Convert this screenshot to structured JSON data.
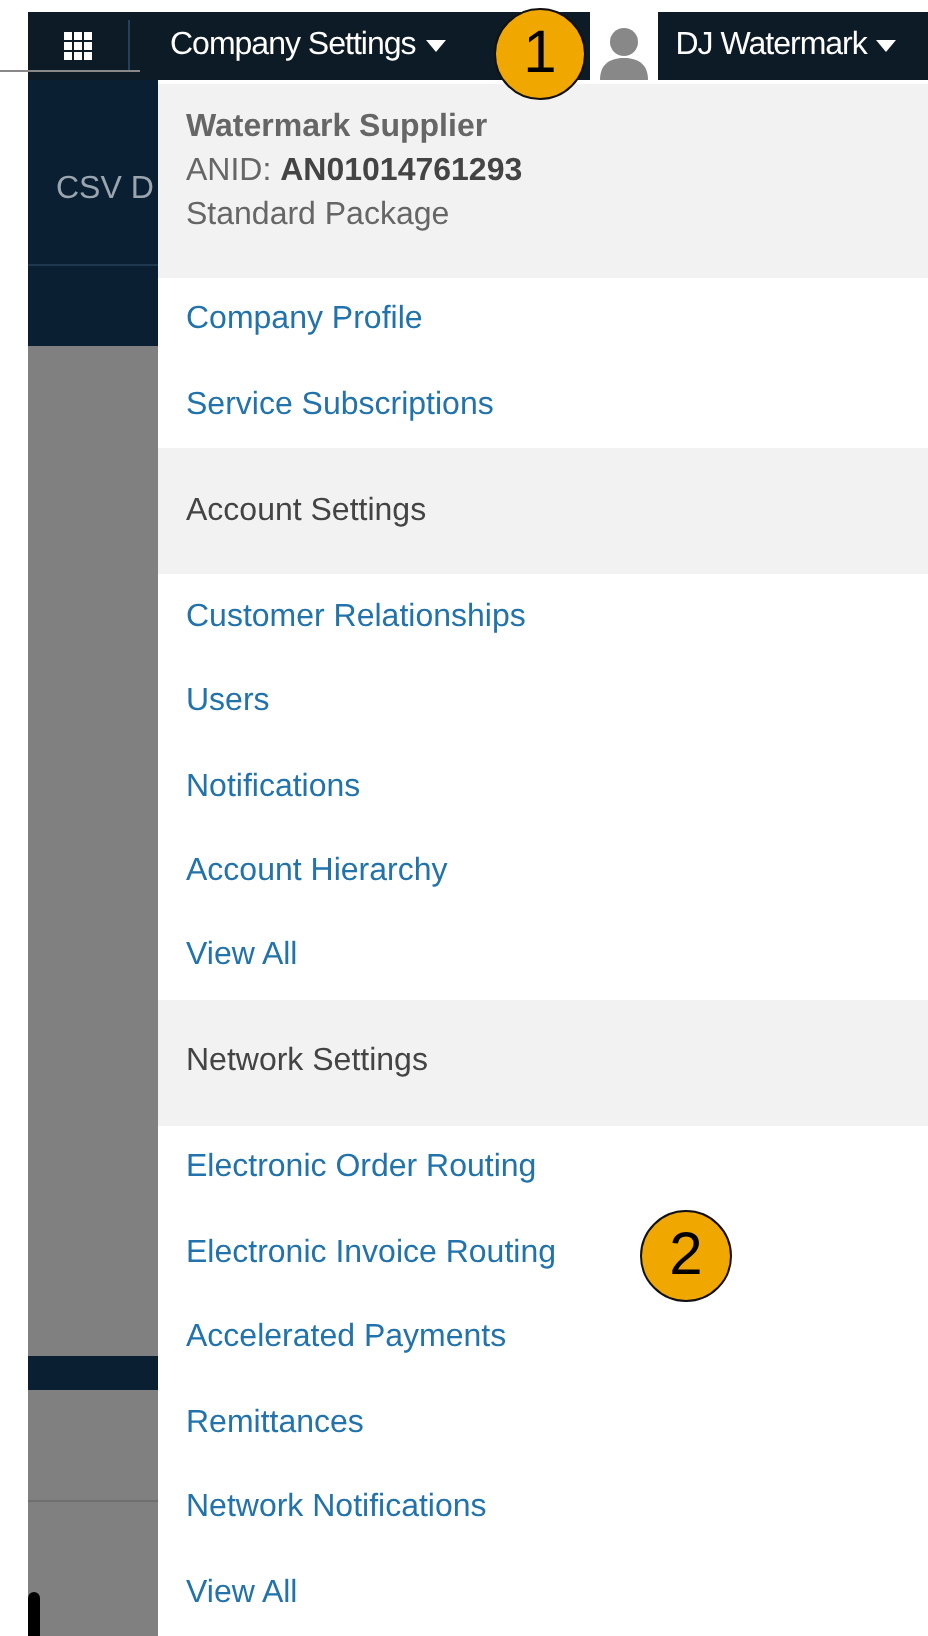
{
  "top_bar": {
    "menu_label": "Company Settings",
    "user_name": "DJ Watermark"
  },
  "background": {
    "tab_label": "CSV D"
  },
  "dropdown": {
    "company_name": "Watermark Supplier",
    "anid_label": "ANID:",
    "anid": "AN01014761293",
    "package": "Standard Package",
    "rows": [
      {
        "kind": "link",
        "text": "Company Profile"
      },
      {
        "kind": "link",
        "text": "Service Subscriptions"
      },
      {
        "kind": "heading",
        "text": "Account Settings"
      },
      {
        "kind": "link",
        "text": "Customer Relationships"
      },
      {
        "kind": "link",
        "text": "Users"
      },
      {
        "kind": "link",
        "text": "Notifications"
      },
      {
        "kind": "link",
        "text": "Account Hierarchy"
      },
      {
        "kind": "link",
        "text": "View All"
      },
      {
        "kind": "heading",
        "text": "Network Settings"
      },
      {
        "kind": "link",
        "text": "Electronic Order Routing"
      },
      {
        "kind": "link",
        "text": "Electronic Invoice Routing"
      },
      {
        "kind": "link",
        "text": "Accelerated Payments"
      },
      {
        "kind": "link",
        "text": "Remittances"
      },
      {
        "kind": "link",
        "text": "Network Notifications"
      },
      {
        "kind": "link",
        "text": "View All"
      }
    ]
  },
  "callouts": [
    "1",
    "2"
  ]
}
